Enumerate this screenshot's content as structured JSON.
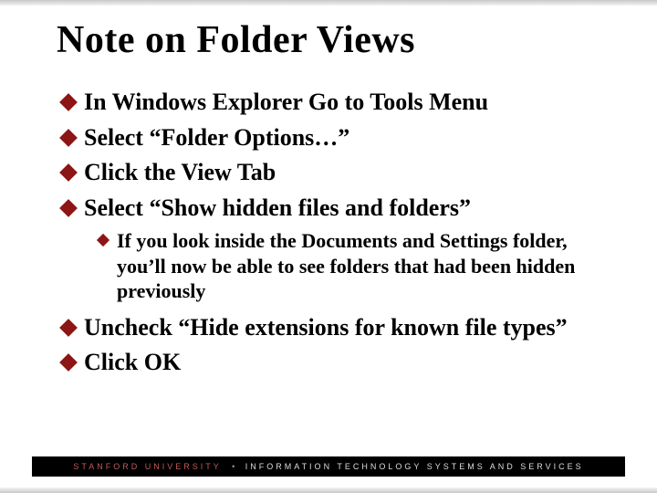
{
  "title": "Note on Folder Views",
  "bullets": {
    "b1": "In Windows Explorer Go to Tools Menu",
    "b2": "Select “Folder Options…”",
    "b3": "Click the View Tab",
    "b4": "Select “Show hidden files and folders”",
    "s4a": "If you look inside the Documents and Settings folder, you’ll now be able to see folders that had been hidden previously",
    "b5": "Uncheck “Hide extensions for known file types”",
    "b6": "Click OK"
  },
  "footer": {
    "brand": "STANFORD UNIVERSITY",
    "sep": "•",
    "dept": "INFORMATION TECHNOLOGY SYSTEMS AND SERVICES"
  },
  "colors": {
    "accent": "#8c1515"
  }
}
